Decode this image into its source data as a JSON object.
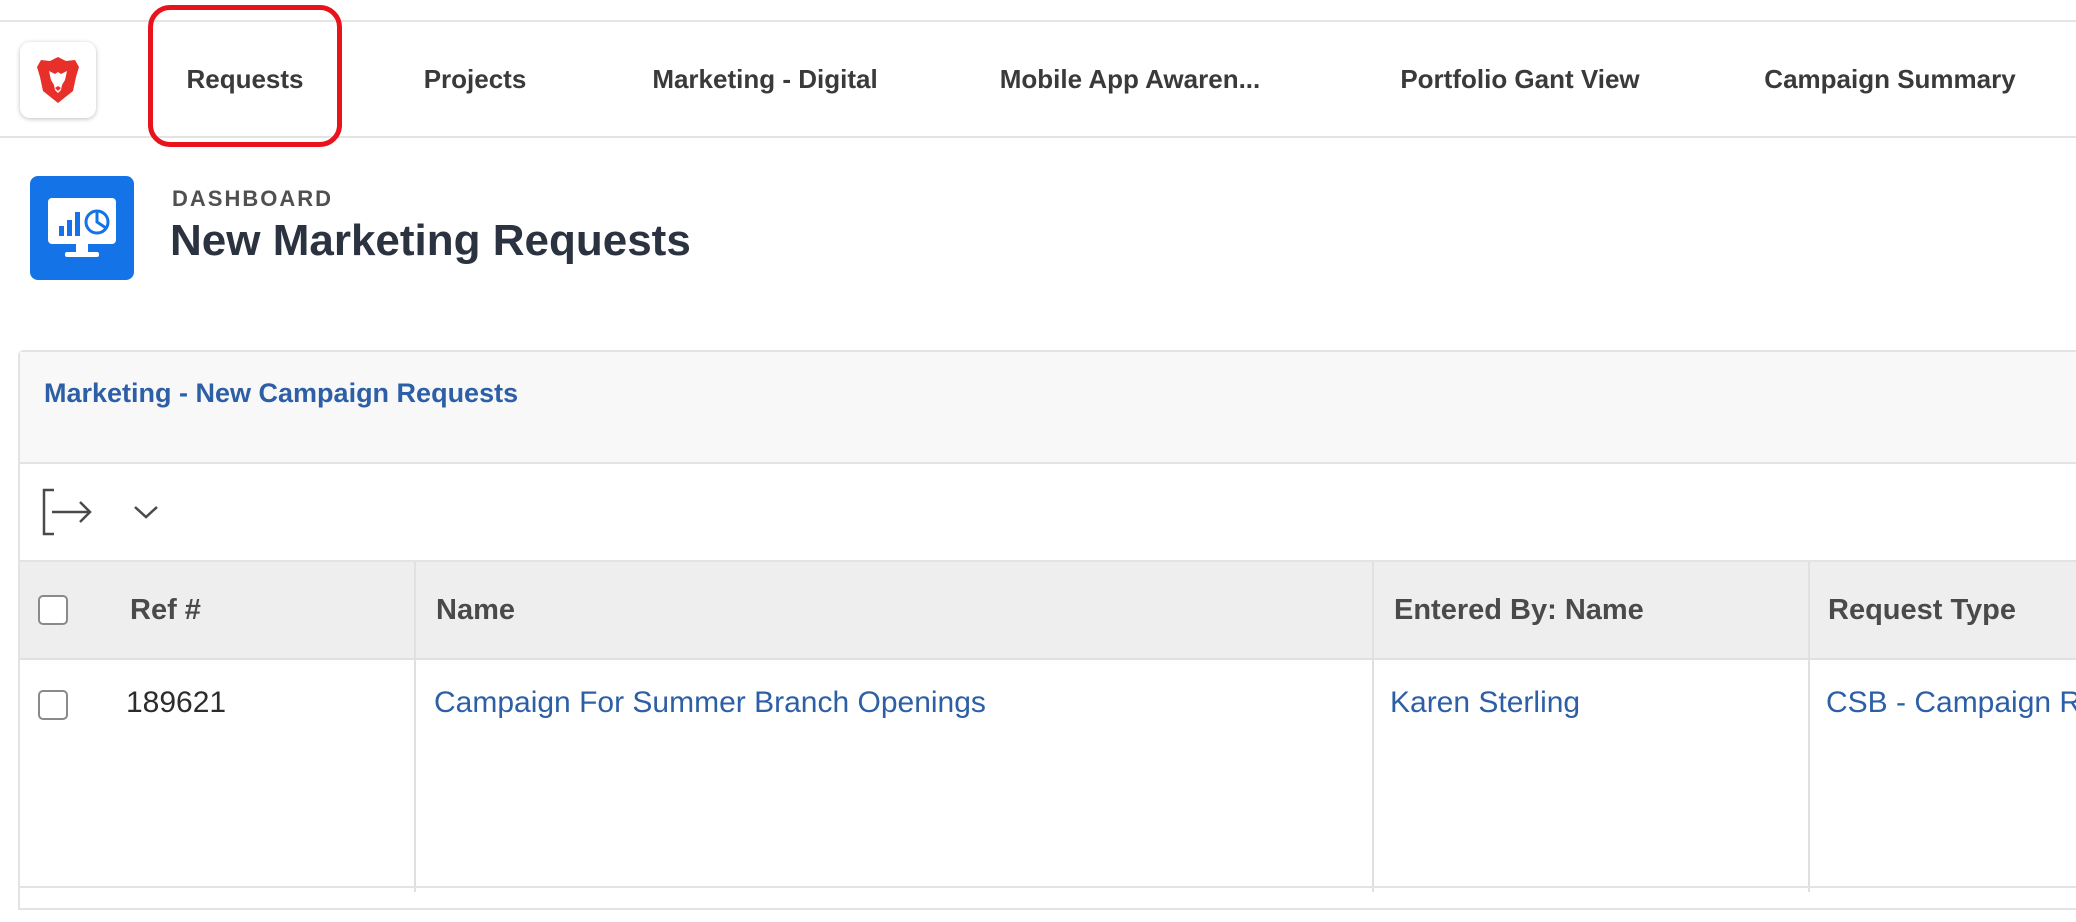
{
  "nav": {
    "logo_icon": "brave-lion-icon",
    "tabs": [
      {
        "label": "Requests"
      },
      {
        "label": "Projects"
      },
      {
        "label": "Marketing - Digital"
      },
      {
        "label": "Mobile App Awaren..."
      },
      {
        "label": "Portfolio Gant View"
      },
      {
        "label": "Campaign Summary"
      }
    ],
    "highlight_color": "#e8131b"
  },
  "dashboard": {
    "icon": "dashboard-monitor-icon",
    "icon_color": "#1473e6",
    "label": "DASHBOARD",
    "title": "New Marketing Requests"
  },
  "report": {
    "title": "Marketing - New Campaign Requests",
    "toolbar": {
      "export_icon": "export-icon",
      "dropdown_icon": "chevron-down-icon"
    },
    "columns": [
      "Ref #",
      "Name",
      "Entered By: Name",
      "Request Type"
    ],
    "rows": [
      {
        "ref": "189621",
        "name": "Campaign For Summer Branch Openings",
        "entered_by": "Karen Sterling",
        "request_type": "CSB - Campaign R"
      }
    ],
    "link_color": "#2d5fa6"
  }
}
